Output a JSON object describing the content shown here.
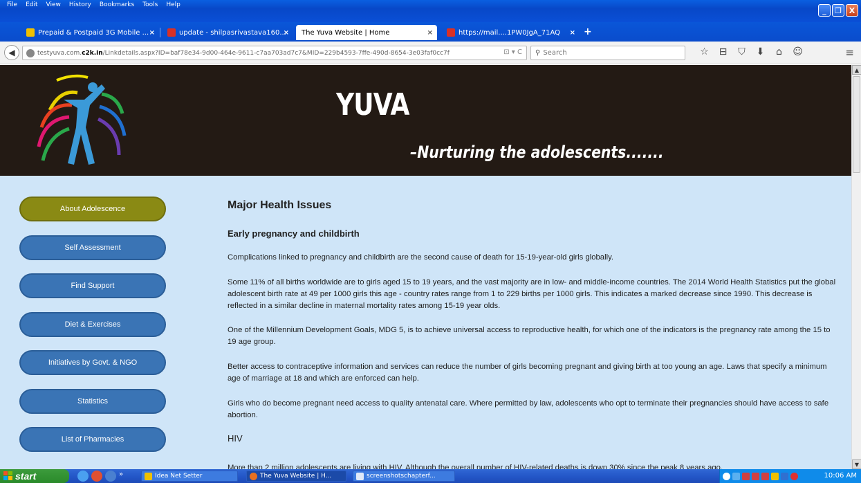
{
  "browser": {
    "menu": [
      "File",
      "Edit",
      "View",
      "History",
      "Bookmarks",
      "Tools",
      "Help"
    ],
    "tabs": [
      {
        "label": "Prepaid & Postpaid 3G Mobile ...",
        "close": "×",
        "icon_color": "#f0c000"
      },
      {
        "label": "update - shilpasrivastava160...",
        "close": "×",
        "icon_color": "#d93025"
      },
      {
        "label": "The Yuva Website | Home",
        "close": "×",
        "icon_color": ""
      },
      {
        "label": "https://mail....1PW0JgA_71AQ",
        "close": "×",
        "icon_color": "#d93025"
      }
    ],
    "new_tab": "+",
    "url_prefix": "testyuva.com.",
    "url_domain": "c2k.in",
    "url_path": "/Linkdetails.aspx?ID=baf78e34-9d00-464e-9611-c7aa703ad7c7&MID=229b4593-7ffe-490d-8654-3e03faf0cc7f",
    "search_placeholder": "Search",
    "window_buttons": [
      "_",
      "❐",
      "X"
    ],
    "toolbar_icons": [
      "☆",
      "⊟",
      "⛉",
      "⬇",
      "⌂",
      "☺"
    ],
    "menu_icon": "≡"
  },
  "site": {
    "title": "YUVA",
    "tagline": "–Nurturing the adolescents......."
  },
  "sidebar": {
    "items": [
      {
        "label": "About Adolescence",
        "active": true
      },
      {
        "label": "Self Assessment",
        "active": false
      },
      {
        "label": "Find Support",
        "active": false
      },
      {
        "label": "Diet & Exercises",
        "active": false
      },
      {
        "label": "Initiatives by Govt. & NGO",
        "active": false
      },
      {
        "label": "Statistics",
        "active": false
      },
      {
        "label": "List of Pharmacies",
        "active": false
      }
    ]
  },
  "content": {
    "heading": "Major Health Issues",
    "subheading": "Early pregnancy and childbirth",
    "paragraphs": [
      "Complications linked to pregnancy and childbirth are the second cause of death for 15-19-year-old girls globally.",
      "Some 11% of all births worldwide are to girls aged 15 to 19 years, and the vast majority are in low- and middle-income countries. The 2014 World Health Statistics put the global adolescent birth rate at 49 per 1000 girls this age - country rates range from 1 to 229 births per 1000 girls. This indicates a marked decrease since 1990. This decrease is reflected in a similar decline in maternal mortality rates among 15-19 year olds.",
      "One of the Millennium Development Goals, MDG 5, is to achieve universal access to reproductive health, for which one of the indicators is the pregnancy rate among the 15 to 19 age group.",
      "Better access to contraceptive information and services can reduce the number of girls becoming pregnant and giving birth at too young an age. Laws that specify a minimum age of marriage at 18 and which are enforced can help.",
      "Girls who do become pregnant need access to quality antenatal care. Where permitted by law, adolescents who opt to terminate their pregnancies should have access to safe abortion."
    ],
    "hiv_heading": "HIV",
    "hiv_paragraph": "More than 2 million adolescents are living with HIV. Although the overall number of HIV-related deaths is down 30% since the peak 8 years ago,"
  },
  "taskbar": {
    "start": "start",
    "chevron": "»",
    "tasks": [
      {
        "label": "Idea Net Setter",
        "active": false
      },
      {
        "label": "The Yuva Website | H...",
        "active": true
      },
      {
        "label": "screenshotschapterf...",
        "active": false
      }
    ],
    "clock": "10:06 AM"
  }
}
